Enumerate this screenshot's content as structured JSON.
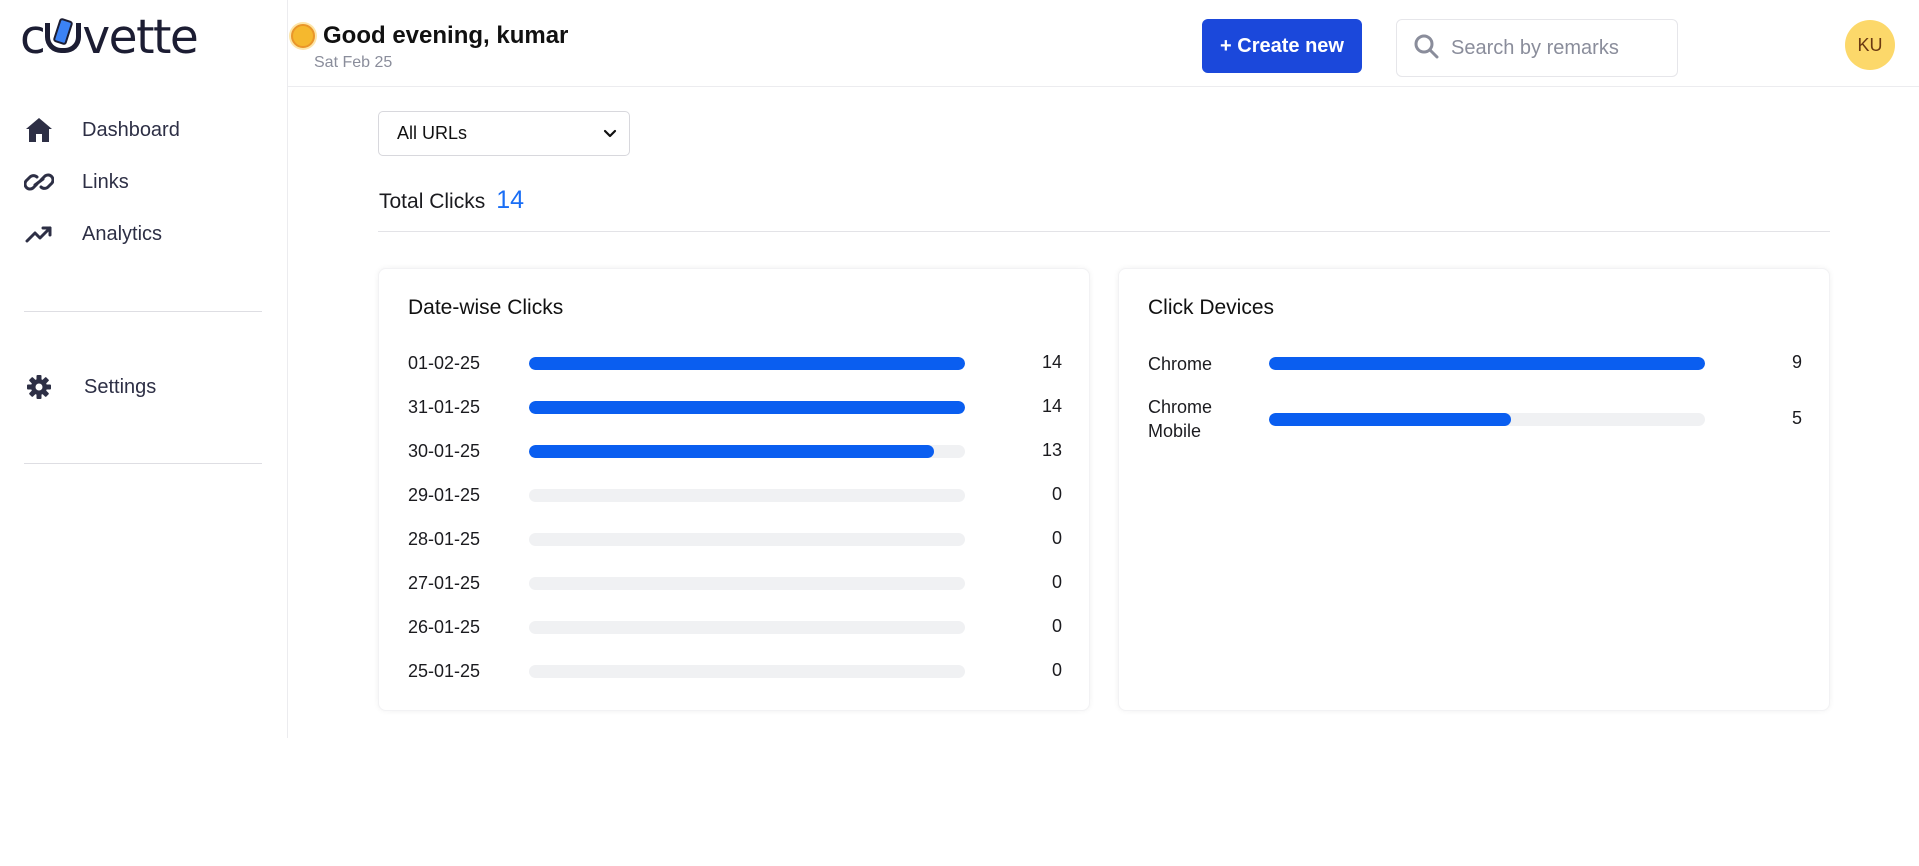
{
  "brand": {
    "logo_text_left": "c",
    "logo_text_right": "vette"
  },
  "sidebar": {
    "items": [
      {
        "label": "Dashboard",
        "icon": "home-icon"
      },
      {
        "label": "Links",
        "icon": "link-icon"
      },
      {
        "label": "Analytics",
        "icon": "trending-up-icon"
      }
    ],
    "settings_label": "Settings"
  },
  "header": {
    "greeting": "Good evening, kumar",
    "date": "Sat Feb 25",
    "create_button": "+ Create new",
    "search_placeholder": "Search by remarks",
    "avatar_initials": "KU"
  },
  "filter": {
    "selected": "All URLs"
  },
  "total_clicks": {
    "label": "Total Clicks",
    "value": "14"
  },
  "date_wise": {
    "title": "Date-wise Clicks",
    "max": 14,
    "rows": [
      {
        "label": "01-02-25",
        "value": 14
      },
      {
        "label": "31-01-25",
        "value": 14
      },
      {
        "label": "30-01-25",
        "value": 13
      },
      {
        "label": "29-01-25",
        "value": 0
      },
      {
        "label": "28-01-25",
        "value": 0
      },
      {
        "label": "27-01-25",
        "value": 0
      },
      {
        "label": "26-01-25",
        "value": 0
      },
      {
        "label": "25-01-25",
        "value": 0
      }
    ]
  },
  "devices": {
    "title": "Click Devices",
    "max": 9,
    "rows": [
      {
        "label": "Chrome",
        "value": 9
      },
      {
        "label": "Chrome Mobile",
        "value": 5
      }
    ]
  },
  "colors": {
    "accent": "#1b48db",
    "bar": "#0a5ef0",
    "track": "#f0f1f3",
    "total_value": "#1a6ef5",
    "avatar_bg": "#fcd86a"
  }
}
